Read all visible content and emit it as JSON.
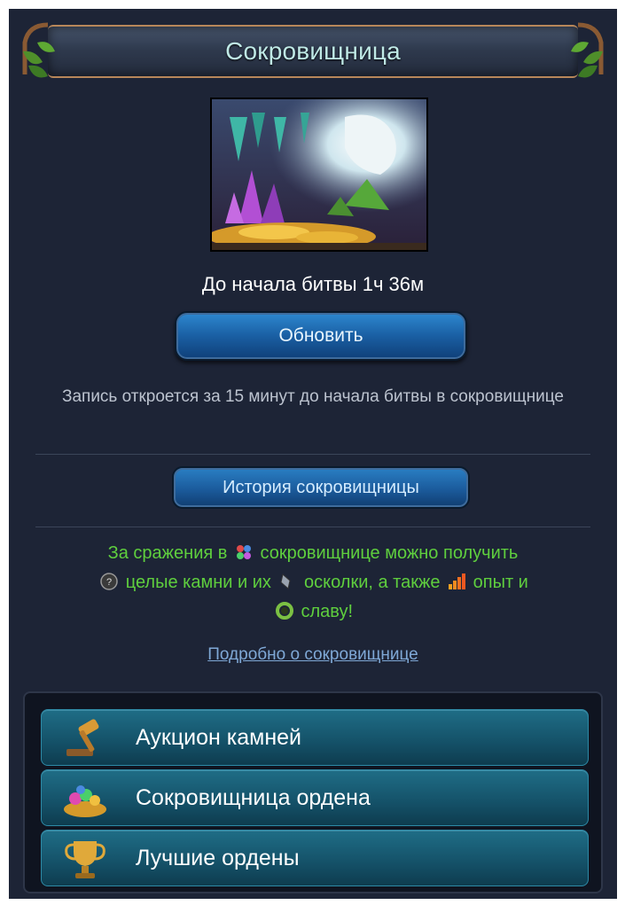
{
  "header": {
    "title": "Сокровищница"
  },
  "battle": {
    "countdown": "До начала битвы 1ч 36м",
    "refresh_label": "Обновить",
    "registration_note": "Запись откроется за 15 минут до начала битвы в сокровищнице"
  },
  "history_label": "История сокровищницы",
  "rewards": {
    "part1": "За сражения в",
    "part2": "сокровищнице можно получить",
    "part3": "целые камни и их",
    "part4": "осколки, а также",
    "part5": "опыт и",
    "part6": "славу!"
  },
  "more_link": "Подробно о сокровищнице",
  "menu": [
    {
      "label": "Аукцион камней",
      "icon": "gavel-icon"
    },
    {
      "label": "Сокровищница ордена",
      "icon": "treasure-pile-icon"
    },
    {
      "label": "Лучшие ордены",
      "icon": "trophy-icon"
    }
  ],
  "colors": {
    "panel_bg": "#1d2436",
    "header_title": "#bfe9e6",
    "rewards_text": "#5fcf3e",
    "link": "#7fa8d6",
    "button_blue": "#1a5fa3",
    "menu_teal": "#15536a"
  }
}
